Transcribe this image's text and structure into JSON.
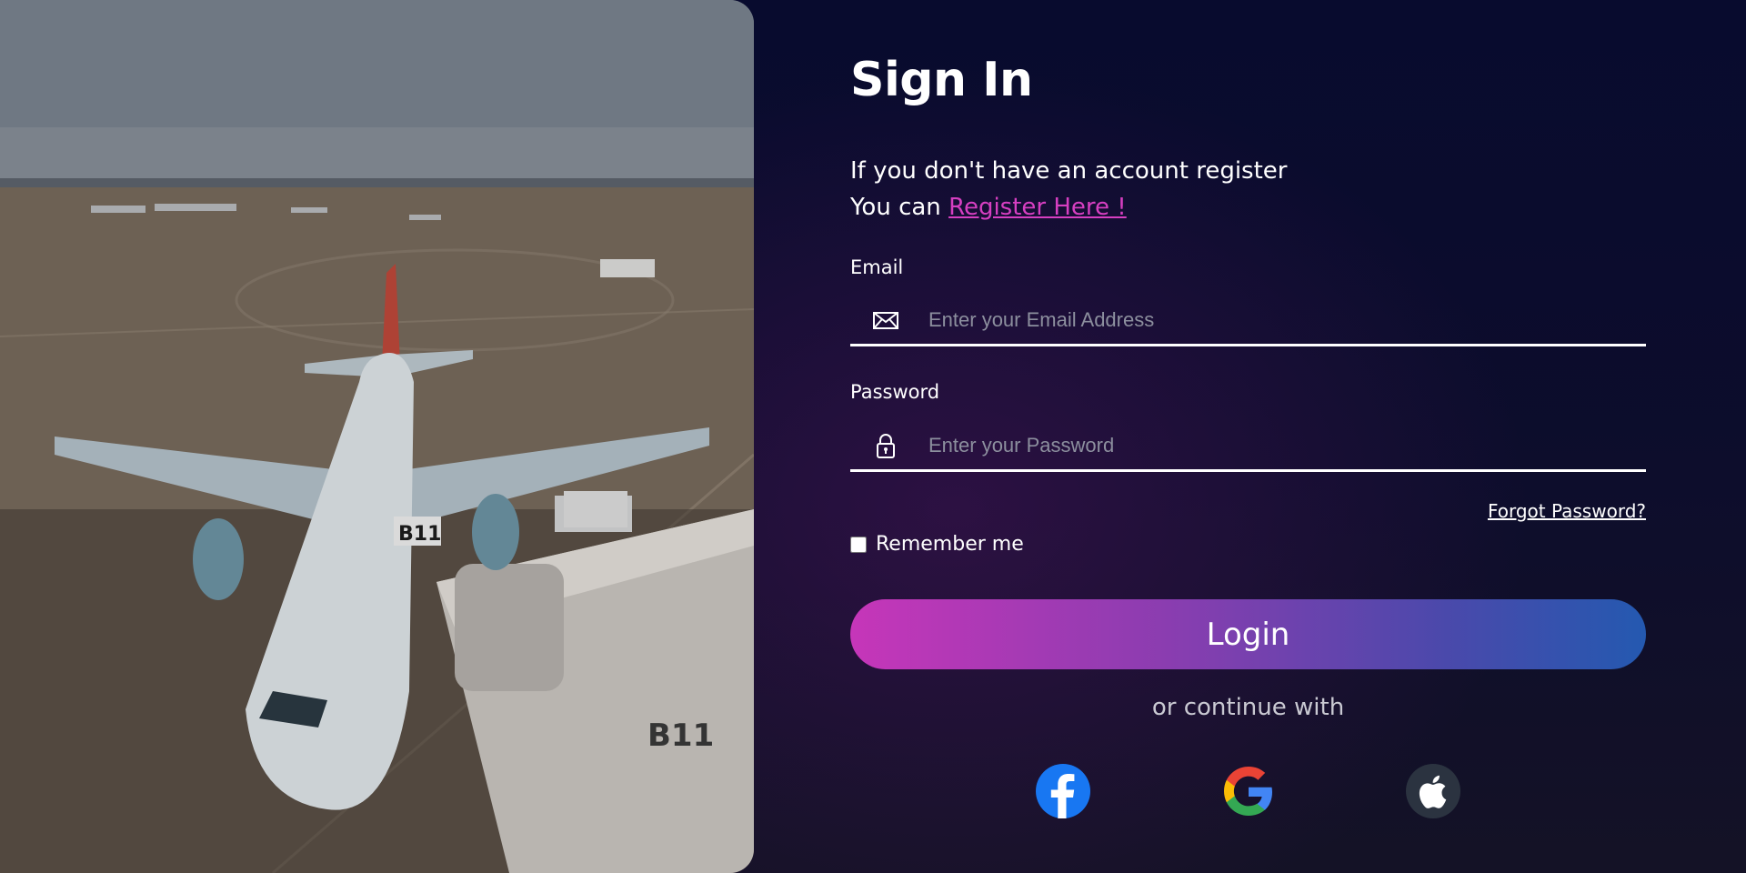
{
  "title": "Sign In",
  "subtitle": {
    "line1": "If you don't have an account register",
    "line2_prefix": "You can ",
    "register_link": "Register Here !"
  },
  "email": {
    "label": "Email",
    "placeholder": "Enter your Email Address",
    "value": "",
    "icon": "envelope-icon"
  },
  "password": {
    "label": "Password",
    "placeholder": "Enter your Password",
    "value": "",
    "icon": "lock-icon"
  },
  "forgot_password": "Forgot Password?",
  "remember_me": {
    "label": "Remember me",
    "checked": false
  },
  "login_button": "Login",
  "continue_with": "or continue with",
  "social": [
    {
      "name": "facebook",
      "icon": "facebook-icon",
      "color": "#1877f2"
    },
    {
      "name": "google",
      "icon": "google-icon",
      "color": "#4285f4"
    },
    {
      "name": "apple",
      "icon": "apple-icon",
      "color": "#2b3340"
    }
  ],
  "colors": {
    "background": "#0b0c2e",
    "link": "#d63fc1",
    "button_gradient_start": "#c636b9",
    "button_gradient_end": "#2459b0"
  },
  "hero": {
    "plane_gate_sign": "B11",
    "jetbridge_sign": "B11"
  }
}
